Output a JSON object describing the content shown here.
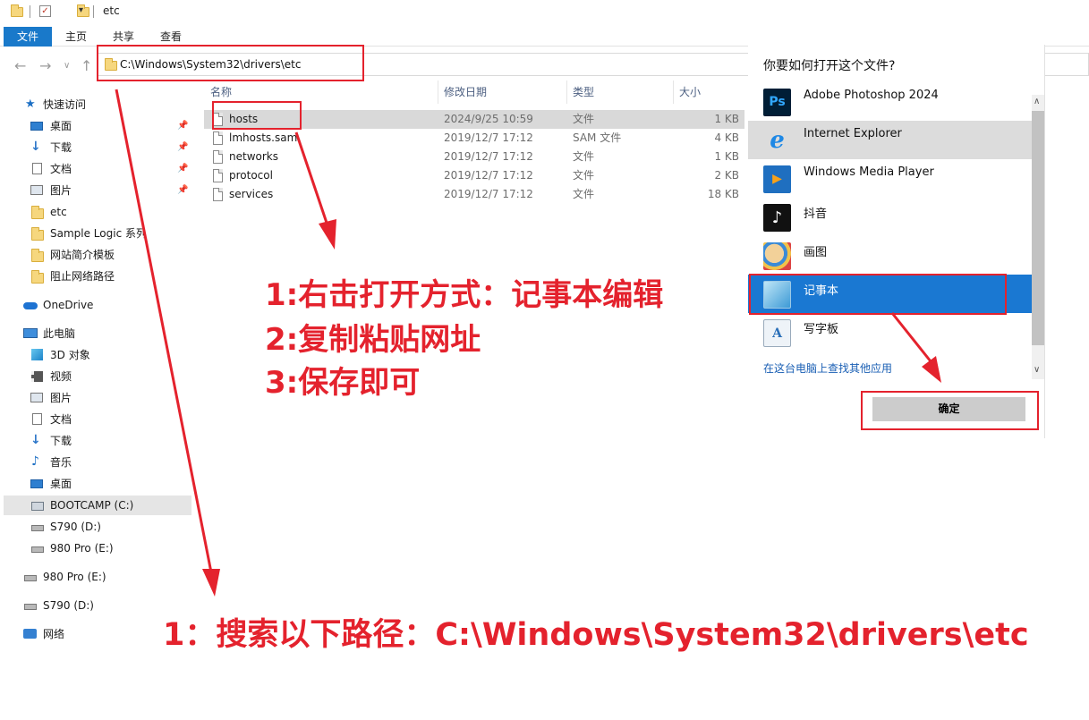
{
  "window": {
    "title": "etc"
  },
  "ribbon": {
    "tabs": [
      "文件",
      "主页",
      "共享",
      "查看"
    ]
  },
  "address": {
    "path": "C:\\Windows\\System32\\drivers\\etc"
  },
  "sidebar": {
    "quick_access": "快速访问",
    "pinned": [
      {
        "label": "桌面",
        "icon": "desktop-icon"
      },
      {
        "label": "下载",
        "icon": "download-icon"
      },
      {
        "label": "文档",
        "icon": "document-icon"
      },
      {
        "label": "图片",
        "icon": "pictures-icon"
      }
    ],
    "recent": [
      "etc",
      "Sample Logic 系列",
      "网站简介模板",
      "阻止网络路径"
    ],
    "onedrive": "OneDrive",
    "this_pc": "此电脑",
    "pc_items": [
      {
        "label": "3D 对象",
        "icon": "3d-objects-icon"
      },
      {
        "label": "视频",
        "icon": "video-icon"
      },
      {
        "label": "图片",
        "icon": "pictures-icon"
      },
      {
        "label": "文档",
        "icon": "document-icon"
      },
      {
        "label": "下载",
        "icon": "download-icon"
      },
      {
        "label": "音乐",
        "icon": "music-icon"
      },
      {
        "label": "桌面",
        "icon": "desktop-icon"
      },
      {
        "label": "BOOTCAMP (C:)",
        "icon": "drive-icon"
      },
      {
        "label": "S790 (D:)",
        "icon": "drive-icon"
      },
      {
        "label": "980 Pro (E:)",
        "icon": "drive-icon"
      }
    ],
    "drives": [
      "980 Pro (E:)",
      "S790 (D:)"
    ],
    "network": "网络"
  },
  "filelist": {
    "columns": [
      "名称",
      "修改日期",
      "类型",
      "大小"
    ],
    "rows": [
      {
        "name": "hosts",
        "date": "2024/9/25 10:59",
        "type": "文件",
        "size": "1 KB"
      },
      {
        "name": "lmhosts.sam",
        "date": "2019/12/7 17:12",
        "type": "SAM 文件",
        "size": "4 KB"
      },
      {
        "name": "networks",
        "date": "2019/12/7 17:12",
        "type": "文件",
        "size": "1 KB"
      },
      {
        "name": "protocol",
        "date": "2019/12/7 17:12",
        "type": "文件",
        "size": "2 KB"
      },
      {
        "name": "services",
        "date": "2019/12/7 17:12",
        "type": "文件",
        "size": "18 KB"
      }
    ]
  },
  "open_with": {
    "title": "你要如何打开这个文件?",
    "apps": [
      {
        "name": "Adobe Photoshop 2024",
        "icon": "photoshop-icon",
        "badge": "Ps"
      },
      {
        "name": "Internet Explorer",
        "icon": "internet-explorer-icon",
        "badge": "e"
      },
      {
        "name": "Windows Media Player",
        "icon": "media-player-icon",
        "badge": "▶"
      },
      {
        "name": "抖音",
        "icon": "douyin-icon",
        "badge": "♪"
      },
      {
        "name": "画图",
        "icon": "paint-icon",
        "badge": ""
      },
      {
        "name": "记事本",
        "icon": "notepad-icon",
        "badge": ""
      },
      {
        "name": "写字板",
        "icon": "wordpad-icon",
        "badge": "A"
      }
    ],
    "more_link": "在这台电脑上查找其他应用",
    "ok": "确定"
  },
  "annotations": {
    "steps_line1": "1:右击打开方式：记事本编辑",
    "steps_line2": "2:复制粘贴网址",
    "steps_line3": "3:保存即可",
    "bottom": "1：搜索以下路径：C:\\Windows\\System32\\drivers\\etc"
  },
  "colors": {
    "annotation_red": "#e4222d",
    "ribbon_file_blue": "#1979ca",
    "selected_app_blue": "#1a78d2"
  }
}
